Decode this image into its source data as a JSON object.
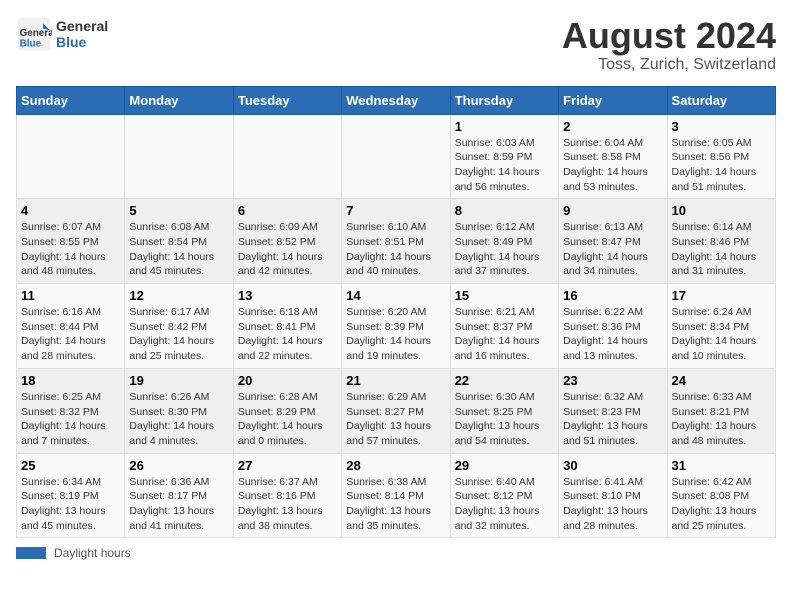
{
  "logo": {
    "line1": "General",
    "line2": "Blue"
  },
  "title": "August 2024",
  "subtitle": "Toss, Zurich, Switzerland",
  "days_of_week": [
    "Sunday",
    "Monday",
    "Tuesday",
    "Wednesday",
    "Thursday",
    "Friday",
    "Saturday"
  ],
  "weeks": [
    [
      {
        "day": "",
        "info": ""
      },
      {
        "day": "",
        "info": ""
      },
      {
        "day": "",
        "info": ""
      },
      {
        "day": "",
        "info": ""
      },
      {
        "day": "1",
        "info": "Sunrise: 6:03 AM\nSunset: 8:59 PM\nDaylight: 14 hours and 56 minutes."
      },
      {
        "day": "2",
        "info": "Sunrise: 6:04 AM\nSunset: 8:58 PM\nDaylight: 14 hours and 53 minutes."
      },
      {
        "day": "3",
        "info": "Sunrise: 6:05 AM\nSunset: 8:56 PM\nDaylight: 14 hours and 51 minutes."
      }
    ],
    [
      {
        "day": "4",
        "info": "Sunrise: 6:07 AM\nSunset: 8:55 PM\nDaylight: 14 hours and 48 minutes."
      },
      {
        "day": "5",
        "info": "Sunrise: 6:08 AM\nSunset: 8:54 PM\nDaylight: 14 hours and 45 minutes."
      },
      {
        "day": "6",
        "info": "Sunrise: 6:09 AM\nSunset: 8:52 PM\nDaylight: 14 hours and 42 minutes."
      },
      {
        "day": "7",
        "info": "Sunrise: 6:10 AM\nSunset: 8:51 PM\nDaylight: 14 hours and 40 minutes."
      },
      {
        "day": "8",
        "info": "Sunrise: 6:12 AM\nSunset: 8:49 PM\nDaylight: 14 hours and 37 minutes."
      },
      {
        "day": "9",
        "info": "Sunrise: 6:13 AM\nSunset: 8:47 PM\nDaylight: 14 hours and 34 minutes."
      },
      {
        "day": "10",
        "info": "Sunrise: 6:14 AM\nSunset: 8:46 PM\nDaylight: 14 hours and 31 minutes."
      }
    ],
    [
      {
        "day": "11",
        "info": "Sunrise: 6:16 AM\nSunset: 8:44 PM\nDaylight: 14 hours and 28 minutes."
      },
      {
        "day": "12",
        "info": "Sunrise: 6:17 AM\nSunset: 8:42 PM\nDaylight: 14 hours and 25 minutes."
      },
      {
        "day": "13",
        "info": "Sunrise: 6:18 AM\nSunset: 8:41 PM\nDaylight: 14 hours and 22 minutes."
      },
      {
        "day": "14",
        "info": "Sunrise: 6:20 AM\nSunset: 8:39 PM\nDaylight: 14 hours and 19 minutes."
      },
      {
        "day": "15",
        "info": "Sunrise: 6:21 AM\nSunset: 8:37 PM\nDaylight: 14 hours and 16 minutes."
      },
      {
        "day": "16",
        "info": "Sunrise: 6:22 AM\nSunset: 8:36 PM\nDaylight: 14 hours and 13 minutes."
      },
      {
        "day": "17",
        "info": "Sunrise: 6:24 AM\nSunset: 8:34 PM\nDaylight: 14 hours and 10 minutes."
      }
    ],
    [
      {
        "day": "18",
        "info": "Sunrise: 6:25 AM\nSunset: 8:32 PM\nDaylight: 14 hours and 7 minutes."
      },
      {
        "day": "19",
        "info": "Sunrise: 6:26 AM\nSunset: 8:30 PM\nDaylight: 14 hours and 4 minutes."
      },
      {
        "day": "20",
        "info": "Sunrise: 6:28 AM\nSunset: 8:29 PM\nDaylight: 14 hours and 0 minutes."
      },
      {
        "day": "21",
        "info": "Sunrise: 6:29 AM\nSunset: 8:27 PM\nDaylight: 13 hours and 57 minutes."
      },
      {
        "day": "22",
        "info": "Sunrise: 6:30 AM\nSunset: 8:25 PM\nDaylight: 13 hours and 54 minutes."
      },
      {
        "day": "23",
        "info": "Sunrise: 6:32 AM\nSunset: 8:23 PM\nDaylight: 13 hours and 51 minutes."
      },
      {
        "day": "24",
        "info": "Sunrise: 6:33 AM\nSunset: 8:21 PM\nDaylight: 13 hours and 48 minutes."
      }
    ],
    [
      {
        "day": "25",
        "info": "Sunrise: 6:34 AM\nSunset: 8:19 PM\nDaylight: 13 hours and 45 minutes."
      },
      {
        "day": "26",
        "info": "Sunrise: 6:36 AM\nSunset: 8:17 PM\nDaylight: 13 hours and 41 minutes."
      },
      {
        "day": "27",
        "info": "Sunrise: 6:37 AM\nSunset: 8:16 PM\nDaylight: 13 hours and 38 minutes."
      },
      {
        "day": "28",
        "info": "Sunrise: 6:38 AM\nSunset: 8:14 PM\nDaylight: 13 hours and 35 minutes."
      },
      {
        "day": "29",
        "info": "Sunrise: 6:40 AM\nSunset: 8:12 PM\nDaylight: 13 hours and 32 minutes."
      },
      {
        "day": "30",
        "info": "Sunrise: 6:41 AM\nSunset: 8:10 PM\nDaylight: 13 hours and 28 minutes."
      },
      {
        "day": "31",
        "info": "Sunrise: 6:42 AM\nSunset: 8:08 PM\nDaylight: 13 hours and 25 minutes."
      }
    ]
  ],
  "footer": {
    "legend_label": "Daylight hours"
  }
}
